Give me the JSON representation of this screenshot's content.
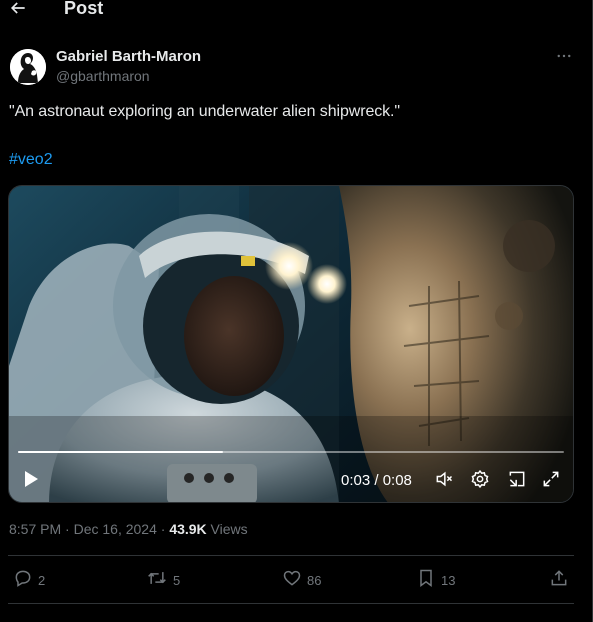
{
  "header": {
    "title": "Post",
    "back_icon": "arrow-left-icon"
  },
  "author": {
    "name": "Gabriel Barth-Maron",
    "handle": "@gbarthmaron",
    "more_icon": "more-horizontal-icon"
  },
  "post": {
    "text": "\"An astronaut exploring an underwater alien shipwreck.\"",
    "hashtag": "#veo2"
  },
  "video": {
    "time_display": "0:03 / 0:08",
    "progress": 0.375,
    "controls": [
      "play-icon",
      "mute-icon",
      "settings-icon",
      "dock-icon",
      "fullscreen-icon"
    ]
  },
  "meta": {
    "timestamp": "8:57 PM · Dec 16, 2024 · ",
    "views_count": "43.9K",
    "views_label": " Views"
  },
  "actions": {
    "reply": {
      "icon": "reply-icon",
      "count": "2"
    },
    "repost": {
      "icon": "repost-icon",
      "count": "5"
    },
    "like": {
      "icon": "heart-icon",
      "count": "86"
    },
    "bookmark": {
      "icon": "bookmark-icon",
      "count": "13"
    },
    "share": {
      "icon": "share-icon"
    }
  },
  "colors": {
    "background": "#000000",
    "text": "#e7e9ea",
    "muted": "#71767b",
    "link": "#1d9bf0",
    "divider": "#2f3336"
  }
}
